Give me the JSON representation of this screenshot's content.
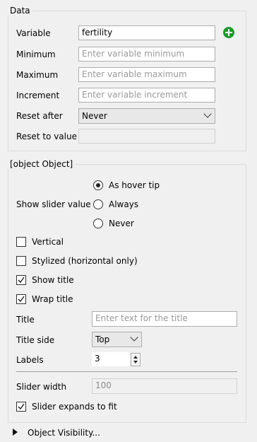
{
  "data_section": {
    "title": "Data",
    "variable": {
      "label": "Variable",
      "value": "fertility"
    },
    "minimum": {
      "label": "Minimum",
      "placeholder": "Enter variable minimum"
    },
    "maximum": {
      "label": "Maximum",
      "placeholder": "Enter variable maximum"
    },
    "increment": {
      "label": "Increment",
      "placeholder": "Enter variable increment"
    },
    "reset_after": {
      "label": "Reset after",
      "value": "Never"
    },
    "reset_to": {
      "label": "Reset to value",
      "value": ""
    }
  },
  "layout_section": {
    "title": {
      "label": "Title",
      "placeholder": "Enter text for the title"
    },
    "show_slider_value": {
      "label": "Show slider value",
      "options": [
        "As hover tip",
        "Always",
        "Never"
      ],
      "selected": "As hover tip"
    },
    "vertical": {
      "label": "Vertical",
      "checked": false
    },
    "stylized": {
      "label": "Stylized (horizontal only)",
      "checked": false
    },
    "show_title": {
      "label": "Show title",
      "checked": true
    },
    "wrap_title": {
      "label": "Wrap title",
      "checked": true
    },
    "title_side": {
      "label": "Title side",
      "value": "Top"
    },
    "labels": {
      "label": "Labels",
      "value": "3"
    },
    "slider_width": {
      "label": "Slider width",
      "value": "100"
    },
    "slider_expands": {
      "label": "Slider expands to fit",
      "checked": true
    }
  },
  "object_visibility": {
    "label": "Object Visibility..."
  },
  "colors": {
    "accent_green": "#1a9c2a"
  }
}
